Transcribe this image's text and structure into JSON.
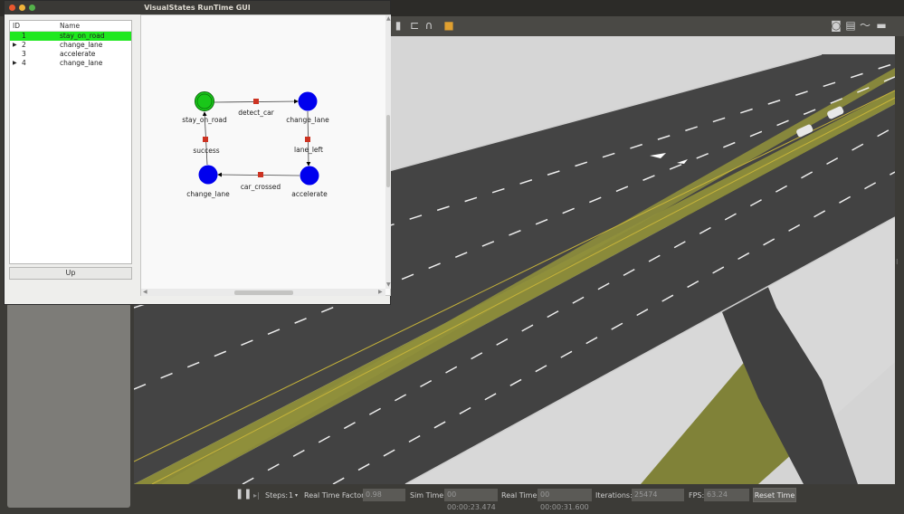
{
  "window": {
    "title": "VisualStates RunTime GUI"
  },
  "tree": {
    "headers": {
      "id": "ID",
      "name": "Name"
    },
    "rows": [
      {
        "id": "1",
        "name": "stay_on_road",
        "expandable": false,
        "selected": true
      },
      {
        "id": "2",
        "name": "change_lane",
        "expandable": true,
        "selected": false
      },
      {
        "id": "3",
        "name": "accelerate",
        "expandable": false,
        "selected": false
      },
      {
        "id": "4",
        "name": "change_lane",
        "expandable": true,
        "selected": false
      }
    ]
  },
  "up_button": "Up",
  "diagram": {
    "states": [
      {
        "name": "stay_on_road",
        "active": true
      },
      {
        "name": "change_lane",
        "active": false
      },
      {
        "name": "accelerate",
        "active": false
      },
      {
        "name": "change_lane",
        "active": false
      }
    ],
    "transitions": [
      {
        "name": "detect_car"
      },
      {
        "name": "lane_left"
      },
      {
        "name": "car_crossed"
      },
      {
        "name": "success"
      }
    ],
    "colors": {
      "active": "#19c719",
      "inactive": "#0000ee",
      "transition": "#cc3322"
    }
  },
  "gazebo": {
    "steps_label": "Steps:",
    "steps_value": "1",
    "rtf_label": "Real Time Factor:",
    "rtf_value": "0.98",
    "sim_time_label": "Sim Time:",
    "sim_time_value": "00 00:00:23.474",
    "real_time_label": "Real Time:",
    "real_time_value": "00 00:00:31.600",
    "iterations_label": "Iterations:",
    "iterations_value": "25474",
    "fps_label": "FPS:",
    "fps_value": "63.24",
    "reset_label": "Reset Time",
    "toolbar_icons": [
      "shape-icon",
      "align-icon",
      "magnet-icon",
      "color-icon",
      "camera-icon",
      "save-icon",
      "chart-icon",
      "log-icon"
    ]
  }
}
